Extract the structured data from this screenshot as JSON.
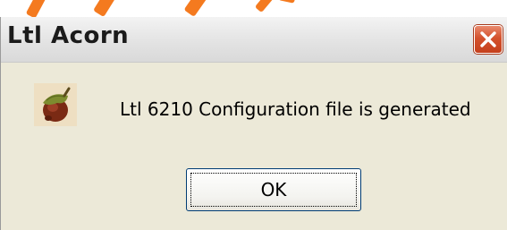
{
  "window": {
    "title": "Ltl Acorn",
    "close_icon": "close-icon"
  },
  "dialog": {
    "icon": "acorn-icon",
    "message": "Ltl 6210 Configuration file is generated",
    "ok_label": "OK"
  },
  "colors": {
    "decoration_orange": "#f47a1f",
    "close_button_red": "#d4522d",
    "dialog_background": "#ece9d8",
    "button_border": "#003c74"
  }
}
